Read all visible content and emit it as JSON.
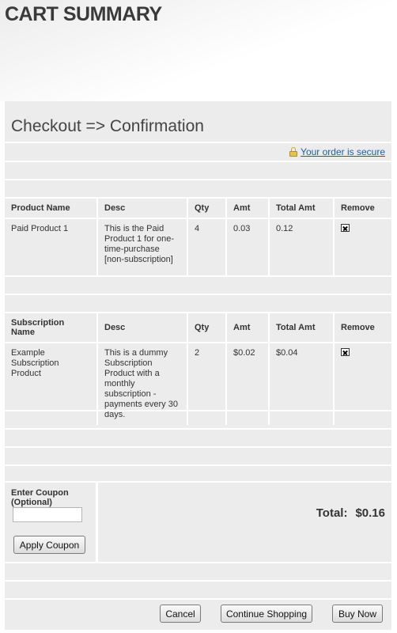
{
  "page": {
    "title": "CART SUMMARY"
  },
  "checkout": {
    "heading": "Checkout => Confirmation",
    "secure_link": "Your order is secure"
  },
  "products": {
    "headers": [
      "Product Name",
      "Desc",
      "Qty",
      "Amt",
      "Total Amt",
      "Remove"
    ],
    "rows": [
      {
        "name": "Paid Product 1",
        "desc": "This is the Paid Product 1 for one-time-purchase [non-subscription]",
        "qty": "4",
        "amt": "0.03",
        "total": "0.12"
      }
    ]
  },
  "subscriptions": {
    "headers": [
      "Subscription Name",
      "Desc",
      "Qty",
      "Amt",
      "Total Amt",
      "Remove"
    ],
    "rows": [
      {
        "name": "Example Subscription Product",
        "desc": "This is a dummy Subscription Product with a monthly subscription - payments every 30 days.",
        "qty": "2",
        "amt": "$0.02",
        "total": "$0.04"
      }
    ]
  },
  "coupon": {
    "label": "Enter Coupon (Optional)",
    "value": "",
    "apply_label": "Apply Coupon"
  },
  "total": {
    "label": "Total:",
    "value": "$0.16"
  },
  "actions": {
    "cancel": "Cancel",
    "continue": "Continue Shopping",
    "buy": "Buy Now"
  }
}
